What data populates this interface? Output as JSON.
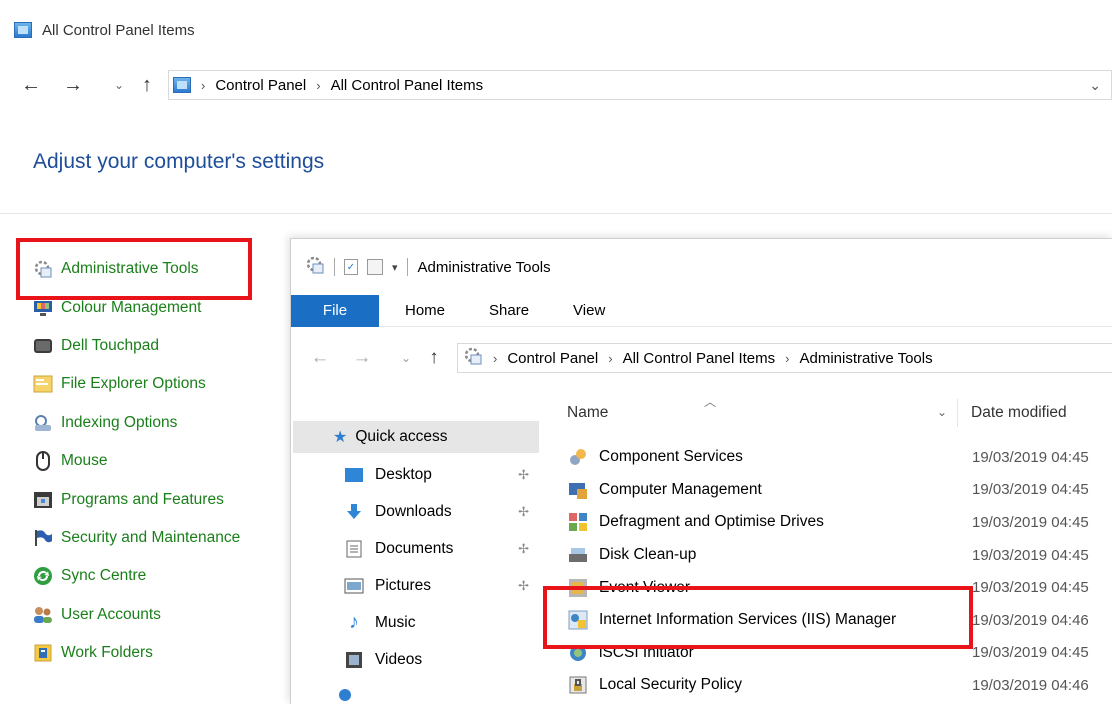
{
  "cp": {
    "title": "All Control Panel Items",
    "breadcrumb": [
      "Control Panel",
      "All Control Panel Items"
    ],
    "heading": "Adjust your computer's settings",
    "items": [
      {
        "label": "Administrative Tools",
        "icon": "gear-tools-icon"
      },
      {
        "label": "Colour Management",
        "icon": "monitor-icon"
      },
      {
        "label": "Dell Touchpad",
        "icon": "touchpad-icon"
      },
      {
        "label": "File Explorer Options",
        "icon": "folder-options-icon"
      },
      {
        "label": "Indexing Options",
        "icon": "indexing-icon"
      },
      {
        "label": "Mouse",
        "icon": "mouse-icon"
      },
      {
        "label": "Programs and Features",
        "icon": "programs-icon"
      },
      {
        "label": "Security and Maintenance",
        "icon": "flag-icon"
      },
      {
        "label": "Sync Centre",
        "icon": "sync-icon"
      },
      {
        "label": "User Accounts",
        "icon": "users-icon"
      },
      {
        "label": "Work Folders",
        "icon": "work-folders-icon"
      }
    ]
  },
  "explorer": {
    "title": "Administrative Tools",
    "ribbon": {
      "file": "File",
      "home": "Home",
      "share": "Share",
      "view": "View"
    },
    "breadcrumb": [
      "Control Panel",
      "All Control Panel Items",
      "Administrative Tools"
    ],
    "sidebar": {
      "quick_access": "Quick access",
      "items": [
        {
          "label": "Desktop",
          "pinned": true
        },
        {
          "label": "Downloads",
          "pinned": true
        },
        {
          "label": "Documents",
          "pinned": true
        },
        {
          "label": "Pictures",
          "pinned": true
        },
        {
          "label": "Music",
          "pinned": false
        },
        {
          "label": "Videos",
          "pinned": false
        }
      ]
    },
    "columns": {
      "name": "Name",
      "date": "Date modified"
    },
    "rows": [
      {
        "name": "Component Services",
        "date": "19/03/2019 04:45"
      },
      {
        "name": "Computer Management",
        "date": "19/03/2019 04:45"
      },
      {
        "name": "Defragment and Optimise Drives",
        "date": "19/03/2019 04:45"
      },
      {
        "name": "Disk Clean-up",
        "date": "19/03/2019 04:45"
      },
      {
        "name": "Event Viewer",
        "date": "19/03/2019 04:45"
      },
      {
        "name": "Internet Information Services (IIS) Manager",
        "date": "19/03/2019 04:46"
      },
      {
        "name": "iSCSI Initiator",
        "date": "19/03/2019 04:45"
      },
      {
        "name": "Local Security Policy",
        "date": "19/03/2019 04:46"
      }
    ]
  },
  "colors": {
    "accent": "#1a6fc5",
    "link_green": "#1a7f1a",
    "heading_blue": "#1e4e9a",
    "highlight": "#e8141a"
  }
}
